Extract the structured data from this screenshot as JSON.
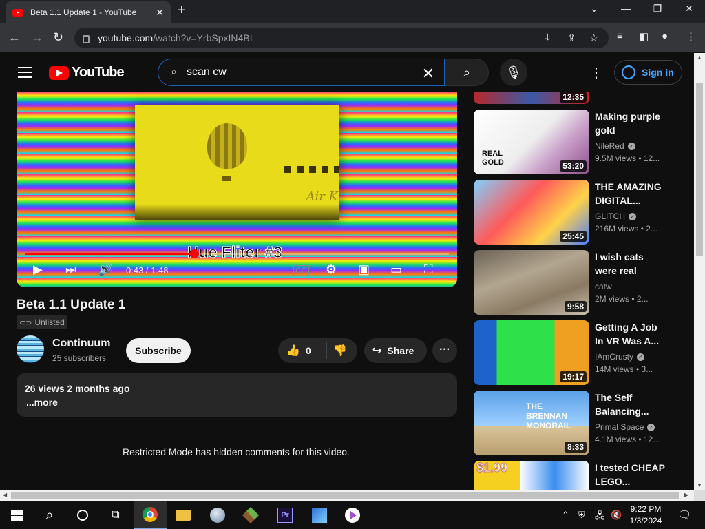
{
  "browser": {
    "tab_title": "Beta 1.1 Update 1 - YouTube",
    "tab_close": "✕",
    "new_tab": "+",
    "url_host": "youtube.com",
    "url_path": "/watch?v=YrbSpxIN4BI",
    "window_controls": [
      "⌄",
      "—",
      "❐",
      "✕"
    ]
  },
  "youtube": {
    "logo_text": "YouTube",
    "search_query": "scan cw",
    "sign_in": "Sign in"
  },
  "player": {
    "caption": "Hue Fliter #3",
    "overlay_text": "Air K",
    "time": "0:43 / 1:48",
    "progress": 0.4
  },
  "video": {
    "title": "Beta 1.1 Update 1",
    "visibility": "Unlisted",
    "channel": "Continuum",
    "subscribers": "25 subscribers",
    "subscribe_label": "Subscribe",
    "likes": "0",
    "share_label": "Share",
    "description_meta": "26 views  2 months ago",
    "more_label": "...more"
  },
  "comments": {
    "restricted_text": "Restricted Mode has hidden comments for this video."
  },
  "sidebar": {
    "top_duration": "12:35",
    "items": [
      {
        "title_l1": "Making purple",
        "title_l2": "gold",
        "channel": "NileRed",
        "views": "9.5M views  • 12...",
        "duration": "53:20",
        "overlay": "REAL GOLD"
      },
      {
        "title_l1": "THE AMAZING",
        "title_l2": "DIGITAL...",
        "channel": "GLITCH",
        "views": "216M views  • 2...",
        "duration": "25:45",
        "overlay": ""
      },
      {
        "title_l1": "I wish cats",
        "title_l2": "were real",
        "channel": "catw",
        "views": "2M views  • 2...",
        "duration": "9:58",
        "overlay": ""
      },
      {
        "title_l1": "Getting A Job",
        "title_l2": "In VR Was A...",
        "channel": "IAmCrusty",
        "views": "14M views  • 3...",
        "duration": "19:17",
        "overlay": ""
      },
      {
        "title_l1": "The Self",
        "title_l2": "Balancing...",
        "channel": "Primal Space",
        "views": "4.1M views  • 12...",
        "duration": "8:33",
        "overlay": "THE BRENNAN MONORAIL"
      },
      {
        "title_l1": "I tested CHEAP",
        "title_l2": "LEGO...",
        "channel": "",
        "views": "",
        "duration": "",
        "overlay": "$1.99"
      }
    ]
  },
  "taskbar": {
    "time": "9:22 PM",
    "date": "1/3/2024"
  },
  "colors": {
    "accent_red": "#ff0000",
    "link_blue": "#3ea6ff",
    "search_border": "#1c62b9"
  }
}
